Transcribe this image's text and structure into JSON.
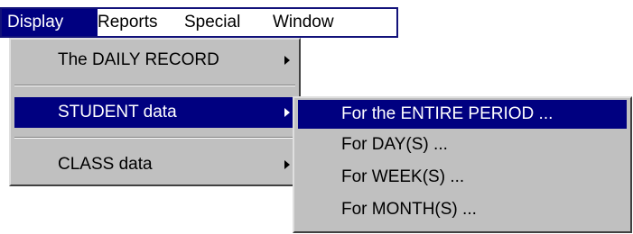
{
  "menubar": {
    "items": [
      {
        "label": "Display"
      },
      {
        "label": "Reports"
      },
      {
        "label": "Special"
      },
      {
        "label": "Window"
      }
    ]
  },
  "display_menu": {
    "items": [
      {
        "label": "The DAILY RECORD",
        "has_submenu": true
      },
      {
        "label": "STUDENT data",
        "has_submenu": true,
        "highlighted": true
      },
      {
        "label": "CLASS data",
        "has_submenu": true
      }
    ]
  },
  "student_submenu": {
    "items": [
      {
        "label": "For the ENTIRE PERIOD ...",
        "highlighted": true
      },
      {
        "label": "For DAY(S) ..."
      },
      {
        "label": "For WEEK(S) ..."
      },
      {
        "label": "For MONTH(S) ..."
      }
    ]
  },
  "colors": {
    "highlight": "#000080",
    "menu_face": "#c0c0c0"
  }
}
